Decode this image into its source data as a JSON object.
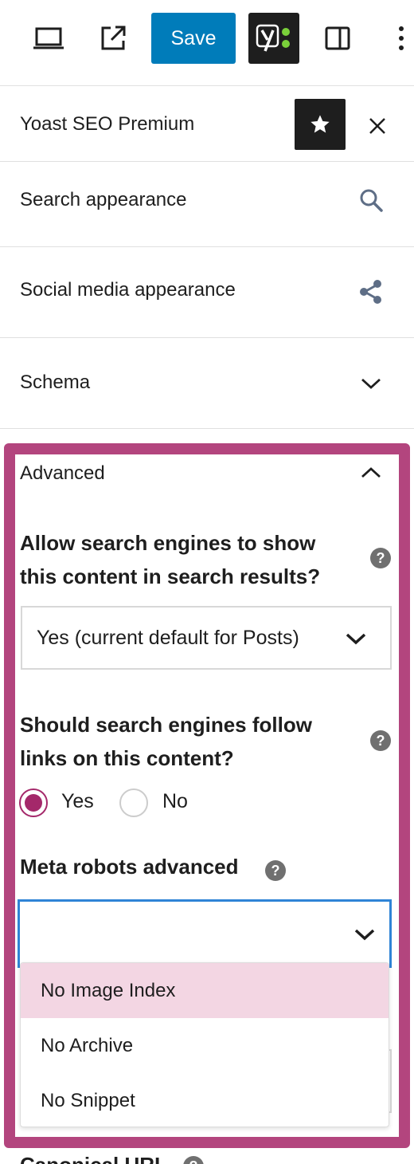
{
  "toolbar": {
    "save_label": "Save",
    "icons": [
      "desktop-preview-icon",
      "external-link-icon",
      "yoast-icon",
      "sidebar-toggle-icon",
      "more-options-icon"
    ]
  },
  "panel": {
    "title": "Yoast SEO Premium"
  },
  "sections": {
    "search_appearance": "Search appearance",
    "social_media": "Social media appearance",
    "schema": "Schema",
    "advanced": "Advanced"
  },
  "advanced": {
    "question_index_line1": "Allow search engines to show",
    "question_index_line2": "this content in search results?",
    "index_select_value": "Yes (current default for Posts)",
    "question_follow_line1": "Should search engines follow",
    "question_follow_line2": "links on this content?",
    "follow_yes": "Yes",
    "follow_no": "No",
    "follow_selected": "Yes",
    "meta_robots_label": "Meta robots advanced",
    "meta_robots_options": [
      "No Image Index",
      "No Archive",
      "No Snippet"
    ],
    "canonical_label": "Canonical URL"
  },
  "colors": {
    "accent_blue": "#007cba",
    "yoast_purple": "#a4286a",
    "highlight_frame": "#b3457e",
    "highlight_option": "#f3d6e3"
  }
}
